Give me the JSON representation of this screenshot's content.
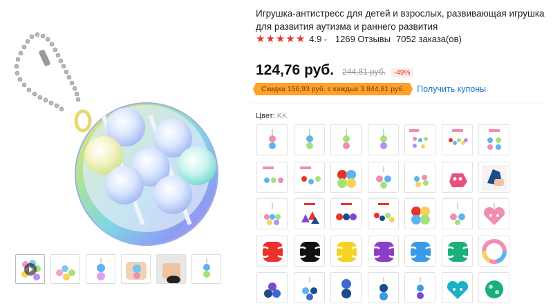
{
  "product": {
    "title": "Игрушка-антистресс для детей и взрослых, развивающая игрушка для развития аутизма и раннего развития",
    "rating": "4.9",
    "reviews": "1269 Отзывы",
    "orders": "7052 заказа(ов)",
    "stars": 5
  },
  "price": {
    "current": "124,76 руб.",
    "original": "244,81 руб.",
    "discount": "-49%"
  },
  "coupon": {
    "text": "Скидка 156,93 руб. с каждых 3 844,81 руб.",
    "link": "Получить купоны"
  },
  "variants": {
    "label": "Цвет:",
    "selected": "KK"
  },
  "colors": {
    "accent": "#e8322a",
    "coupon_bg": "#ffa12b",
    "link": "#1a73c9"
  }
}
